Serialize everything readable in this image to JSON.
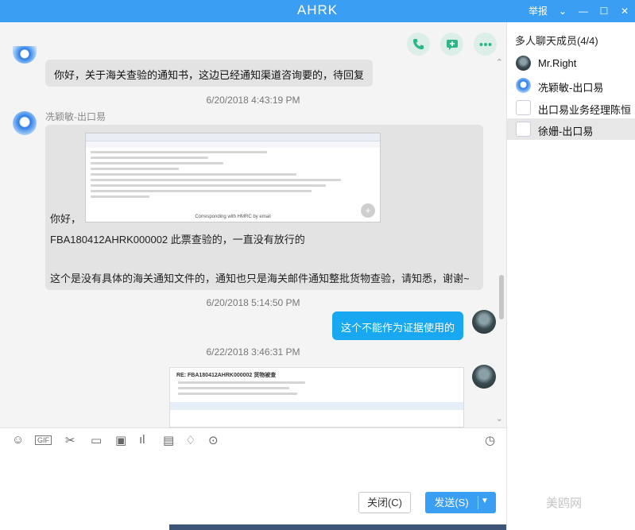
{
  "window": {
    "title": "AHRK",
    "report_label": "举报",
    "controls": [
      "⌄",
      "—",
      "☐",
      "✕"
    ]
  },
  "chat": {
    "msg1_text": "你好，关于海关查验的通知书，这边已经通知渠道咨询要的，待回复",
    "ts1": "6/20/2018 4:43:19 PM",
    "msg2_sender": "冼颖敏-出口易",
    "msg2_image_caption": "Corresponding with HMRC by email",
    "msg2_line1": "你好，",
    "msg2_line2": "FBA180412AHRK000002 此票查验的，一直没有放行的",
    "msg2_line3": "这个是没有具体的海关通知文件的，通知也只是海关邮件通知整批货物查验，请知悉，谢谢~",
    "ts2": "6/20/2018 5:14:50 PM",
    "msg3_text": "这个不能作为证据使用的",
    "ts3": "6/22/2018 3:46:31 PM",
    "msg4_subject": "RE: FBA180412AHRK000002 货物被查"
  },
  "toolbar": {
    "icons": [
      "smiley-icon",
      "gif-icon",
      "scissors-icon",
      "folder-icon",
      "image-icon",
      "chart-icon",
      "calendar-icon",
      "bell-icon",
      "more-icon",
      "history-icon"
    ]
  },
  "buttons": {
    "close_label": "关闭(C)",
    "send_label": "发送(S)"
  },
  "sidebar": {
    "header": "多人聊天成员(4/4)",
    "members": [
      {
        "name": "Mr.Right"
      },
      {
        "name": "冼颖敏-出口易"
      },
      {
        "name": "出口易业务经理陈恒"
      },
      {
        "name": "徐姗-出口易"
      }
    ]
  },
  "watermark": "美鸥网",
  "colors": {
    "accent": "#3a9ef3",
    "bubble_blue": "#18a8f1",
    "bubble_gray": "#e3e3e3"
  }
}
